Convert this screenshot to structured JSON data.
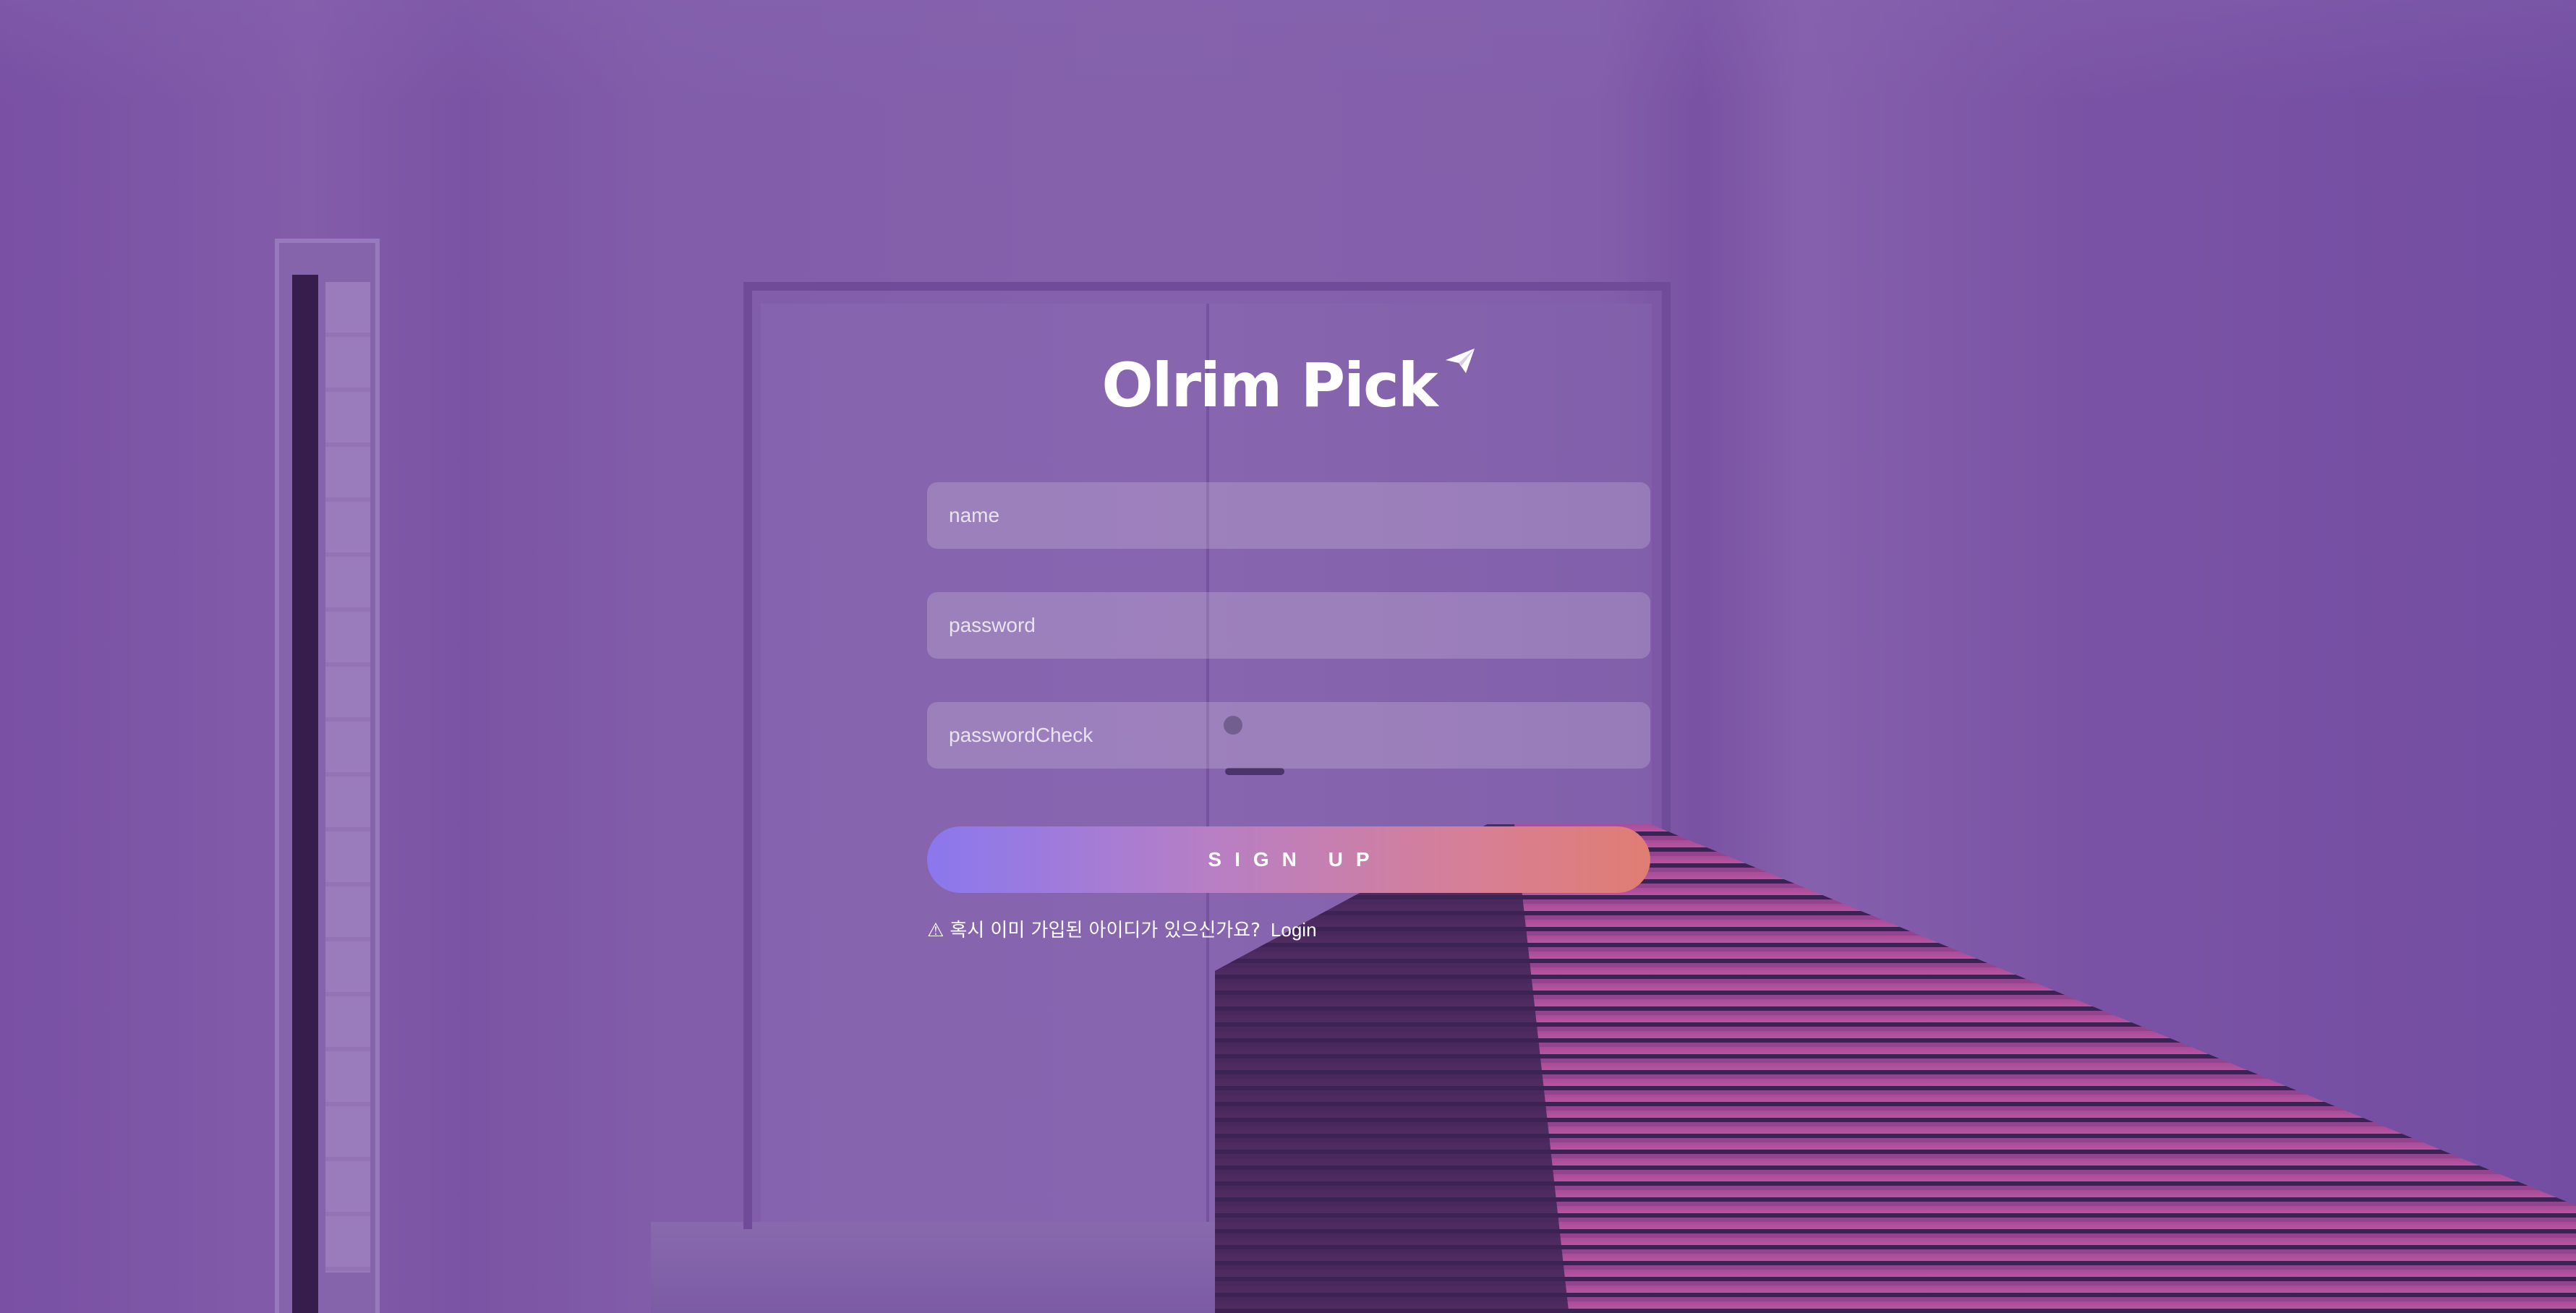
{
  "brand": {
    "title": "Olrim Pick",
    "icon": "paper-plane-icon"
  },
  "form": {
    "name_placeholder": "name",
    "password_placeholder": "password",
    "password_check_placeholder": "passwordCheck",
    "signup_label": "SIGN UP"
  },
  "notice": {
    "icon": "⚠",
    "text": "혹시 이미 가입된 아이디가 있으신가요?",
    "login_label": "Login"
  },
  "colors": {
    "accent_start": "#8a78ee",
    "accent_end": "#e07d72",
    "text": "#ffffff"
  }
}
